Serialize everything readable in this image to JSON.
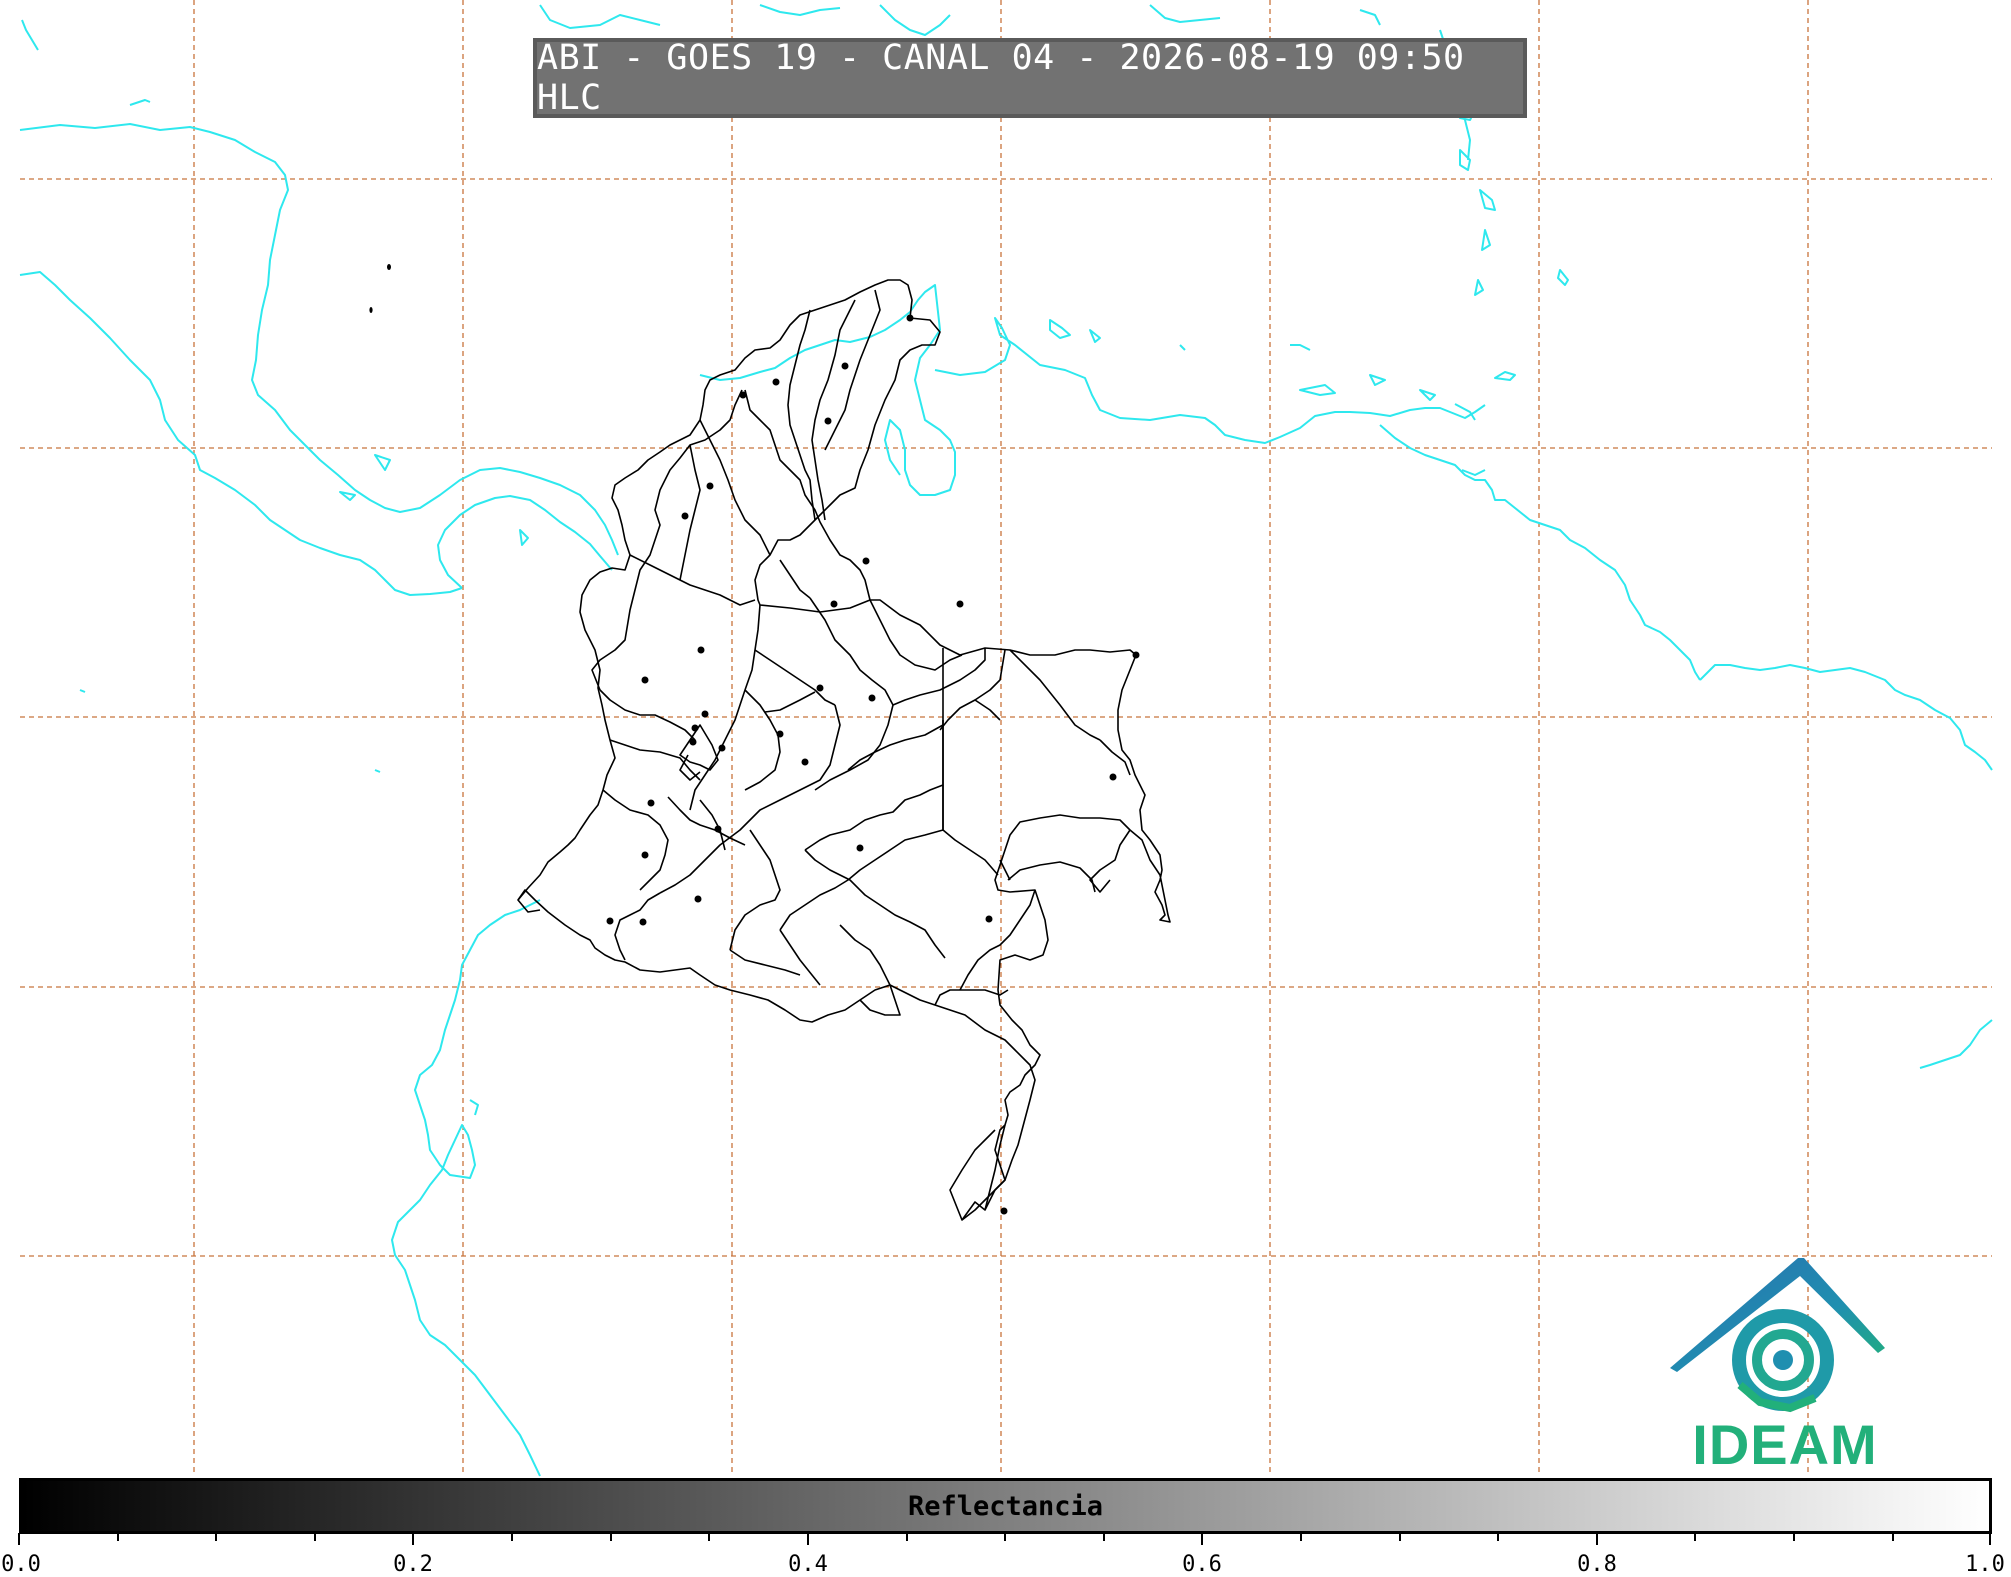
{
  "title": "ABI - GOES 19 - CANAL 04 - 2026-08-19 09:50 HLC",
  "colorbar": {
    "label": "Reflectancia",
    "range": [
      0.0,
      1.0
    ],
    "colors": [
      "#000000",
      "#ffffff"
    ],
    "tick_labels": [
      "0.0",
      "0.2",
      "0.4",
      "0.6",
      "0.8",
      "1.0"
    ]
  },
  "logo": {
    "text": "IDEAM",
    "colors": [
      "#22b07a",
      "#1f8fb0",
      "#2a6fb0"
    ]
  },
  "map_colors": {
    "coastline": "#2ee8ee",
    "borders": "#000000",
    "graticule": "#c8743c",
    "cities": "#000000"
  },
  "icons": {
    "logo": "ideam-logo-icon"
  }
}
